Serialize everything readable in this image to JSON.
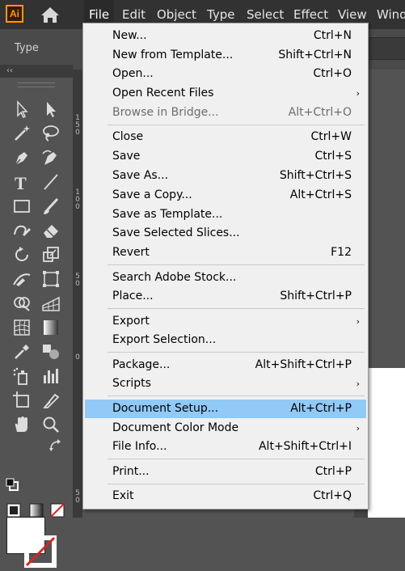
{
  "app": {
    "logo_text": "Ai"
  },
  "menubar": {
    "items": [
      "File",
      "Edit",
      "Object",
      "Type",
      "Select",
      "Effect",
      "View",
      "Wind"
    ]
  },
  "controlbar": {
    "label": "Type"
  },
  "toolbar": {
    "collapse_label": "‹‹"
  },
  "ruler": {
    "labels": [
      "1\n5\n0",
      "1\n0\n0",
      "5\n0",
      "0",
      "5\n0"
    ]
  },
  "file_menu": {
    "items": [
      {
        "label": "New...",
        "shortcut": "Ctrl+N"
      },
      {
        "label": "New from Template...",
        "shortcut": "Shift+Ctrl+N"
      },
      {
        "label": "Open...",
        "shortcut": "Ctrl+O"
      },
      {
        "label": "Open Recent Files",
        "shortcut": "",
        "submenu": true
      },
      {
        "label": "Browse in Bridge...",
        "shortcut": "Alt+Ctrl+O",
        "disabled": true
      },
      {
        "label": "Close",
        "shortcut": "Ctrl+W"
      },
      {
        "label": "Save",
        "shortcut": "Ctrl+S"
      },
      {
        "label": "Save As...",
        "shortcut": "Shift+Ctrl+S"
      },
      {
        "label": "Save a Copy...",
        "shortcut": "Alt+Ctrl+S"
      },
      {
        "label": "Save as Template...",
        "shortcut": ""
      },
      {
        "label": "Save Selected Slices...",
        "shortcut": ""
      },
      {
        "label": "Revert",
        "shortcut": "F12"
      },
      {
        "label": "Search Adobe Stock...",
        "shortcut": ""
      },
      {
        "label": "Place...",
        "shortcut": "Shift+Ctrl+P"
      },
      {
        "label": "Export",
        "shortcut": "",
        "submenu": true
      },
      {
        "label": "Export Selection...",
        "shortcut": ""
      },
      {
        "label": "Package...",
        "shortcut": "Alt+Shift+Ctrl+P"
      },
      {
        "label": "Scripts",
        "shortcut": "",
        "submenu": true
      },
      {
        "label": "Document Setup...",
        "shortcut": "Alt+Ctrl+P",
        "highlighted": true
      },
      {
        "label": "Document Color Mode",
        "shortcut": "",
        "submenu": true
      },
      {
        "label": "File Info...",
        "shortcut": "Alt+Shift+Ctrl+I"
      },
      {
        "label": "Print...",
        "shortcut": "Ctrl+P"
      },
      {
        "label": "Exit",
        "shortcut": "Ctrl+Q"
      }
    ]
  },
  "colors": {
    "menubar_bg": "#323232",
    "highlight": "#91c9f7",
    "ai_orange": "#ff9a00"
  }
}
